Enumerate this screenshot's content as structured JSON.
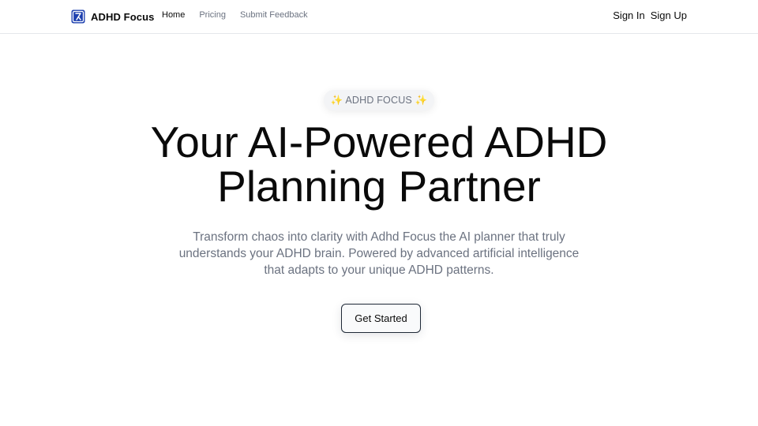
{
  "brand": {
    "name": "ADHD Focus",
    "logo_icon": "brand-logo-icon",
    "logo_color": "#1e40af"
  },
  "nav": {
    "links": [
      {
        "label": "Home",
        "active": true
      },
      {
        "label": "Pricing",
        "active": false
      },
      {
        "label": "Submit Feedback",
        "active": false
      }
    ],
    "auth": {
      "sign_in": "Sign In",
      "sign_up": "Sign Up"
    }
  },
  "hero": {
    "badge": "✨ ADHD FOCUS ✨",
    "title_lines": [
      "Your AI-Powered ADHD",
      "Planning Partner"
    ],
    "subtitle_lines": [
      "Transform chaos into clarity with Adhd Focus the AI planner that truly",
      "understands your ADHD brain. Powered by advanced artificial intelligence",
      "that adapts to your unique ADHD patterns."
    ],
    "cta_label": "Get Started"
  }
}
